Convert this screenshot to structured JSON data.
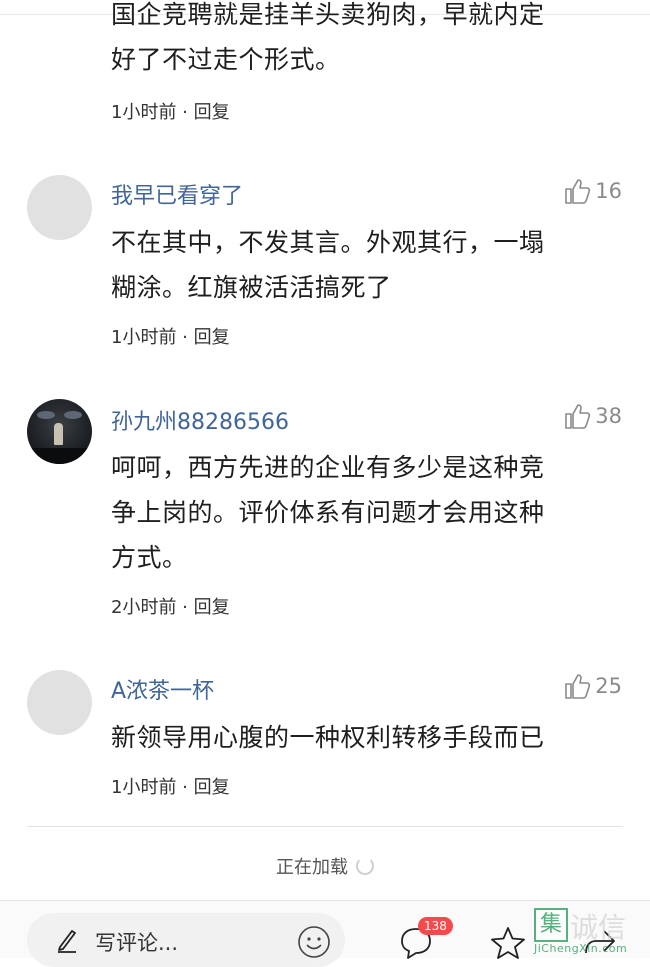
{
  "comments": [
    {
      "text_lines": [
        "国企竞聘就是挂羊头卖狗肉，早就内定",
        "好了不过走个形式。"
      ],
      "time": "1小时前",
      "reply": "回复"
    },
    {
      "name": "我早已看穿了",
      "likes": "16",
      "text_lines": [
        "不在其中，不发其言。外观其行，一塌",
        "糊涂。红旗被活活搞死了"
      ],
      "time": "1小时前",
      "reply": "回复"
    },
    {
      "name": "孙九州88286566",
      "likes": "38",
      "text_lines": [
        "呵呵，西方先进的企业有多少是这种竞",
        "争上岗的。评价体系有问题才会用这种",
        "方式。"
      ],
      "time": "2小时前",
      "reply": "回复"
    },
    {
      "name": "A浓茶一杯",
      "likes": "25",
      "text_lines": [
        "新领导用心腹的一种权利转移手段而已"
      ],
      "time": "1小时前",
      "reply": "回复"
    }
  ],
  "separator": " · ",
  "loading_text": "正在加载",
  "bottom_bar": {
    "comment_placeholder": "写评论...",
    "comment_count": "138"
  },
  "watermark": {
    "box_char": "集",
    "text": "诚信",
    "url": "JiChengXin.com"
  },
  "icons": [
    "thumb-up-icon",
    "pen-icon",
    "smile-icon",
    "chat-icon",
    "star-icon",
    "share-icon",
    "spinner-icon"
  ],
  "colors": {
    "username": "#406599",
    "badge": "#f34b4b",
    "avatar_placeholder": "#e1e1e1"
  }
}
